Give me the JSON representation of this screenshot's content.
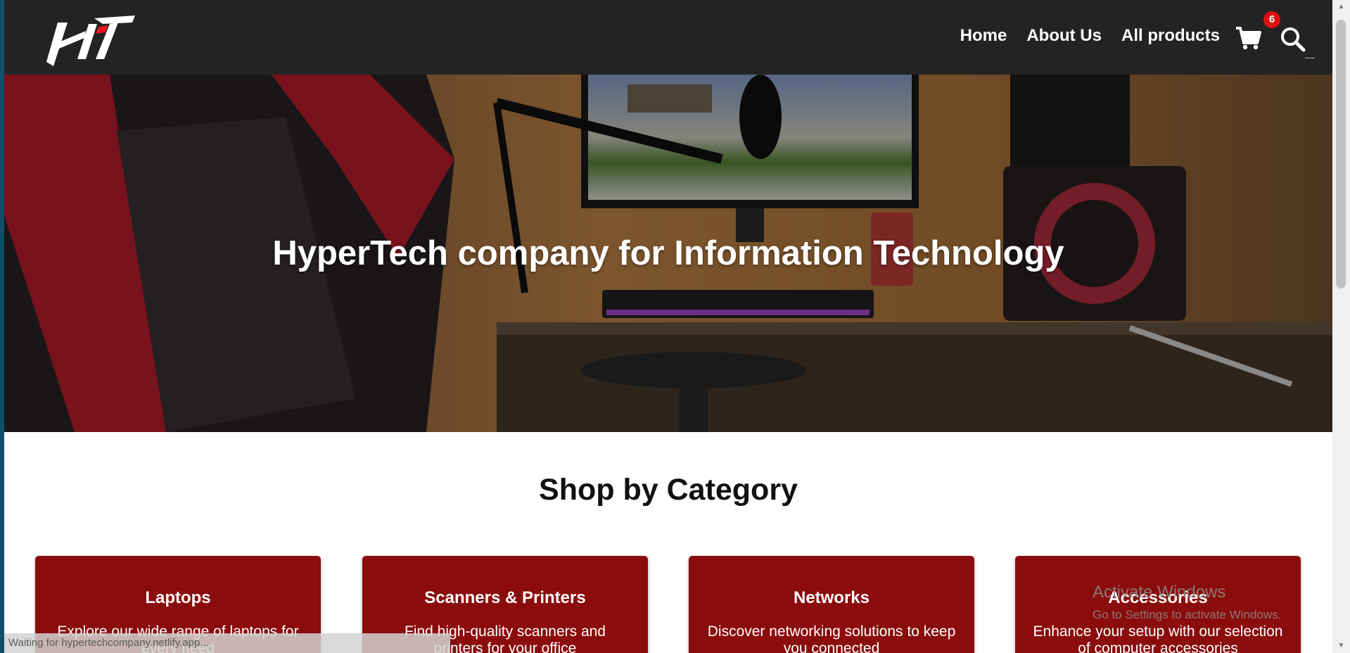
{
  "site": {
    "nav": {
      "links": [
        "Home",
        "About Us",
        "All products"
      ],
      "cart_count": "6"
    },
    "hero": {
      "title": "HyperTech company for Information Technology"
    },
    "section": {
      "title": "Shop by Category"
    },
    "categories": [
      {
        "title": "Laptops",
        "desc": "Explore our wide range of laptops for every need"
      },
      {
        "title": "Scanners & Printers",
        "desc": "Find high-quality scanners and printers for your office"
      },
      {
        "title": "Networks",
        "desc": "Discover networking solutions to keep you connected"
      },
      {
        "title": "Accessories",
        "desc": "Enhance your setup with our selection of computer accessories"
      }
    ]
  },
  "browser": {
    "status_text": "Waiting for hypertechcompany.netlify.app..."
  },
  "os_watermark": {
    "title": "Activate Windows",
    "subtitle": "Go to Settings to activate Windows."
  },
  "colors": {
    "navbar": "#232323",
    "card": "#8b0c0c",
    "badge": "#e01010"
  },
  "icons": [
    "logo",
    "cart-icon",
    "search-icon"
  ]
}
